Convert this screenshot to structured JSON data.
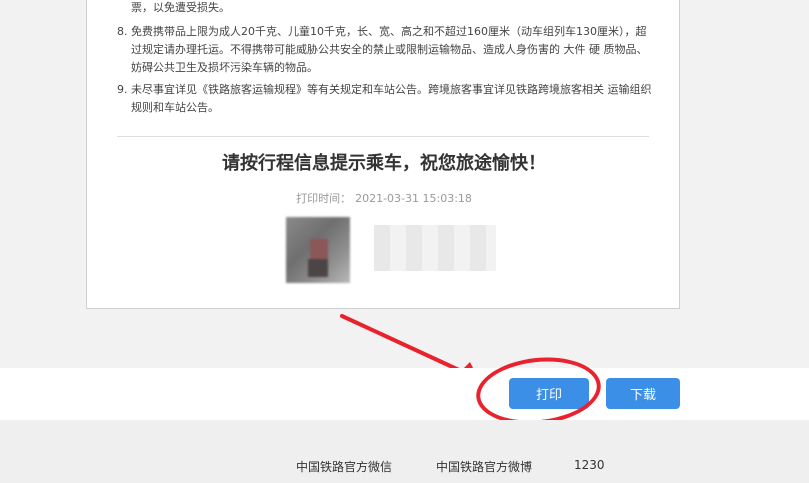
{
  "notices": {
    "tail_text": "票，以免遭受损失。",
    "item8": {
      "number": "8.",
      "text": "免费携带品上限为成人20千克、儿童10千克，长、宽、高之和不超过160厘米（动车组列车130厘米），超过规定请办理托运。不得携带可能威胁公共安全的禁止或限制运输物品、造成人身伤害的 大件 硬 质物品、妨碍公共卫生及损坏污染车辆的物品。"
    },
    "item9": {
      "number": "9.",
      "text": "未尽事宜详见《铁路旅客运输规程》等有关规定和车站公告。跨境旅客事宜详见铁路跨境旅客相关 运输组织规则和车站公告。"
    }
  },
  "main_title": "请按行程信息提示乘车，祝您旅途愉快！",
  "print_time": {
    "label": "打印时间：",
    "value": "2021-03-31 15:03:18"
  },
  "buttons": {
    "print": "打印",
    "download": "下载"
  },
  "footer": {
    "links": [
      "中国铁路官方微信",
      "中国铁路官方微博",
      "1230"
    ]
  },
  "colors": {
    "accent_button": "#3b8fe6",
    "annotation_red": "#e8232e"
  }
}
